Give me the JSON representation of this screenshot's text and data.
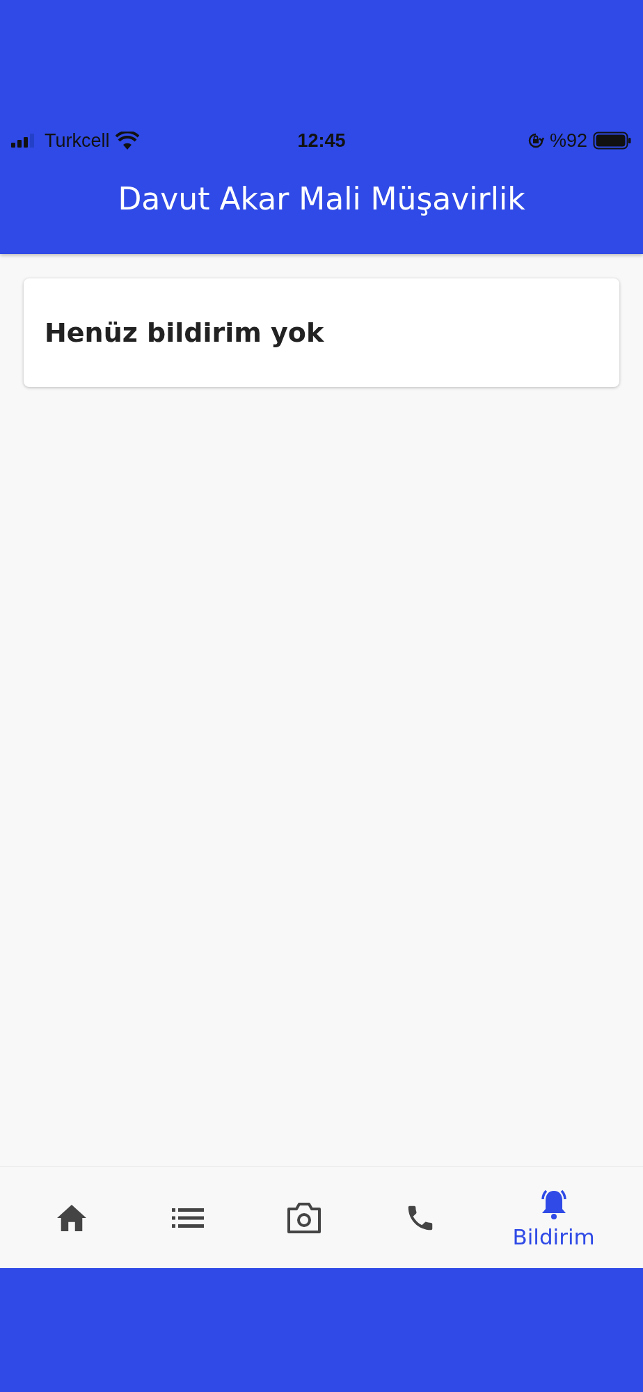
{
  "status_bar": {
    "carrier": "Turkcell",
    "time": "12:45",
    "battery": "%92"
  },
  "app_bar": {
    "title": "Davut Akar Mali Müşavirlik"
  },
  "notice": {
    "text": "Henüz bildirim yok"
  },
  "bottom_nav": [
    {
      "kind": "home",
      "selected": false
    },
    {
      "kind": "list",
      "selected": false
    },
    {
      "kind": "camera",
      "selected": false
    },
    {
      "kind": "phone",
      "selected": false
    },
    {
      "kind": "bell",
      "selected": true,
      "label": "Bildirim"
    }
  ]
}
